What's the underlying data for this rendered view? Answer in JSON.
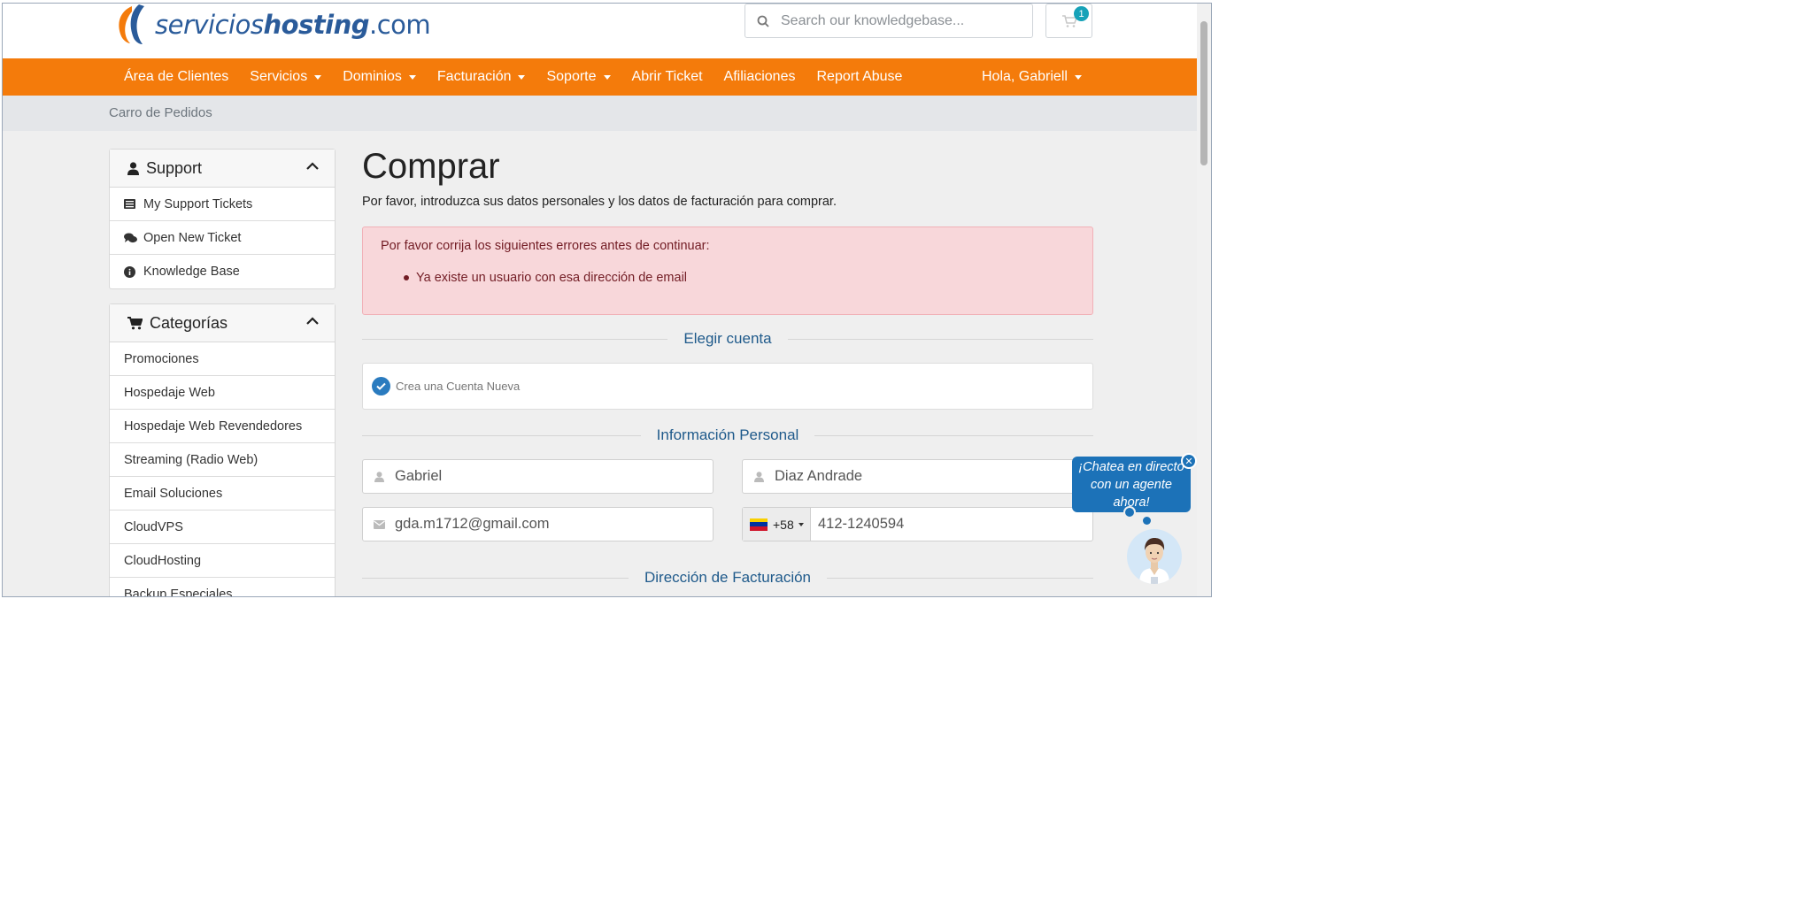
{
  "header": {
    "logo": {
      "part1": "servicios",
      "part2": "hosting",
      "part3": ".com"
    },
    "search": {
      "placeholder": "Search our knowledgebase..."
    },
    "cart": {
      "count": "1"
    }
  },
  "nav": {
    "items": [
      {
        "label": "Área de Clientes",
        "dropdown": false
      },
      {
        "label": "Servicios",
        "dropdown": true
      },
      {
        "label": "Dominios",
        "dropdown": true
      },
      {
        "label": "Facturación",
        "dropdown": true
      },
      {
        "label": "Soporte",
        "dropdown": true
      },
      {
        "label": "Abrir Ticket",
        "dropdown": false
      },
      {
        "label": "Afiliaciones",
        "dropdown": false
      },
      {
        "label": "Report Abuse",
        "dropdown": false
      }
    ],
    "user": "Hola, Gabriell"
  },
  "breadcrumb": "Carro de Pedidos",
  "sidebar": {
    "support": {
      "title": "Support",
      "items": [
        "My Support Tickets",
        "Open New Ticket",
        "Knowledge Base"
      ]
    },
    "categories": {
      "title": "Categorías",
      "items": [
        "Promociones",
        "Hospedaje Web",
        "Hospedaje Web Revendedores",
        "Streaming (Radio Web)",
        "Email Soluciones",
        "CloudVPS",
        "CloudHosting",
        "Backup Especiales"
      ]
    }
  },
  "main": {
    "title": "Comprar",
    "subtitle": "Por favor, introduzca sus datos personales y los datos de facturación para comprar.",
    "alert": {
      "heading": "Por favor corrija los siguientes errores antes de continuar:",
      "errors": [
        "Ya existe un usuario con esa dirección de email"
      ]
    },
    "account_section": "Elegir cuenta",
    "new_account_label": "Crea una Cuenta Nueva",
    "personal_section": "Información Personal",
    "first_name": "Gabriel",
    "last_name": "Diaz Andrade",
    "email": "gda.m1712@gmail.com",
    "phone_code": "+58",
    "phone": "412-1240594",
    "billing_section": "Dirección de Facturación"
  },
  "chat": {
    "text": "¡Chatea en directo con un agente ahora!"
  },
  "colors": {
    "nav": "#f47b0b",
    "brand_blue": "#2a5b9a",
    "alert_bg": "#f8d7da",
    "chat": "#1c72b8"
  }
}
